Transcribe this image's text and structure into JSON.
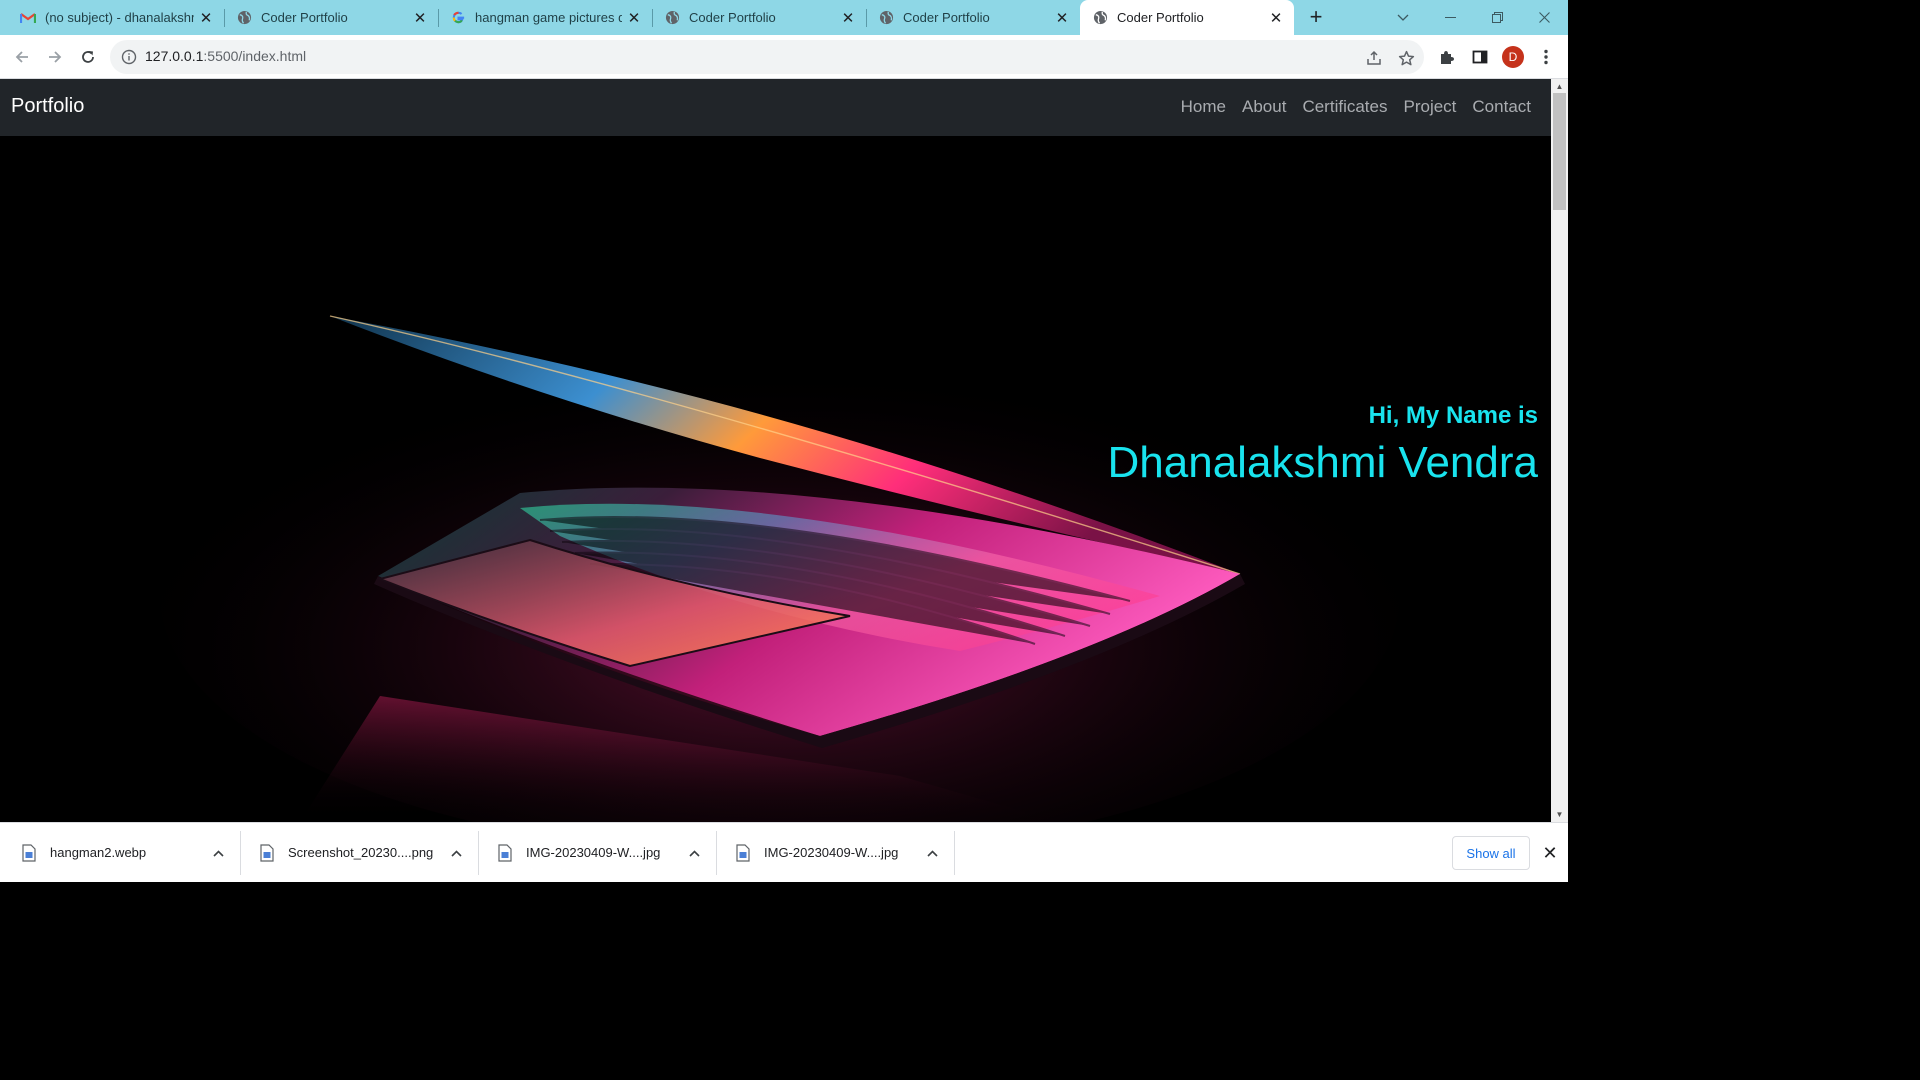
{
  "browser": {
    "tabs": [
      {
        "title": "(no subject) - dhanalakshmi",
        "icon": "gmail-icon",
        "active": false
      },
      {
        "title": "Coder Portfolio",
        "icon": "globe-icon",
        "active": false
      },
      {
        "title": "hangman game pictures do",
        "icon": "google-icon",
        "active": false
      },
      {
        "title": "Coder Portfolio",
        "icon": "globe-icon",
        "active": false
      },
      {
        "title": "Coder Portfolio",
        "icon": "globe-icon",
        "active": false
      },
      {
        "title": "Coder Portfolio",
        "icon": "globe-icon",
        "active": true
      }
    ],
    "url_host": "127.0.0.1",
    "url_path": ":5500/index.html",
    "profile_initial": "D",
    "colors": {
      "tabstrip": "#8ed7e6",
      "profile": "#c5321b"
    }
  },
  "site": {
    "brand": "Portfolio",
    "nav": [
      "Home",
      "About",
      "Certificates",
      "Project",
      "Contact"
    ],
    "hero": {
      "greeting": "Hi, My Name is",
      "name": "Dhanalakshmi Vendra",
      "accent_color": "#19e3ee",
      "background": "laptop-neon-image"
    }
  },
  "downloads": {
    "items": [
      {
        "name": "hangman2.webp"
      },
      {
        "name": "Screenshot_20230....png"
      },
      {
        "name": "IMG-20230409-W....jpg"
      },
      {
        "name": "IMG-20230409-W....jpg"
      }
    ],
    "show_all": "Show all"
  }
}
